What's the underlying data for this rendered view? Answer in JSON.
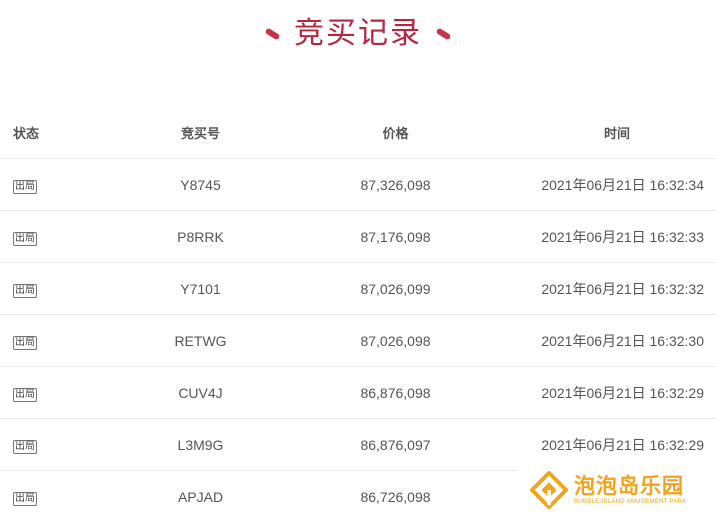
{
  "header": {
    "title": "竞买记录"
  },
  "table": {
    "columns": {
      "status": "状态",
      "bid_no": "竞买号",
      "price": "价格",
      "time": "时间"
    },
    "rows": [
      {
        "status": "出局",
        "bid_no": "Y8745",
        "price": "87,326,098",
        "time": "2021年06月21日 16:32:34"
      },
      {
        "status": "出局",
        "bid_no": "P8RRK",
        "price": "87,176,098",
        "time": "2021年06月21日 16:32:33"
      },
      {
        "status": "出局",
        "bid_no": "Y7101",
        "price": "87,026,099",
        "time": "2021年06月21日 16:32:32"
      },
      {
        "status": "出局",
        "bid_no": "RETWG",
        "price": "87,026,098",
        "time": "2021年06月21日 16:32:30"
      },
      {
        "status": "出局",
        "bid_no": "CUV4J",
        "price": "86,876,098",
        "time": "2021年06月21日 16:32:29"
      },
      {
        "status": "出局",
        "bid_no": "L3M9G",
        "price": "86,876,097",
        "time": "2021年06月21日 16:32:29"
      },
      {
        "status": "出局",
        "bid_no": "APJAD",
        "price": "86,726,098",
        "time": ""
      }
    ]
  },
  "watermark": {
    "name_cn": "泡泡岛乐园",
    "name_en": "BUBBLE ISLAND AMUSEMENT PARK"
  },
  "colors": {
    "title": "#b8253f",
    "accent": "#c7324d",
    "text": "#555555",
    "divider": "#e9e9e9",
    "watermark": "#f3a21a"
  }
}
